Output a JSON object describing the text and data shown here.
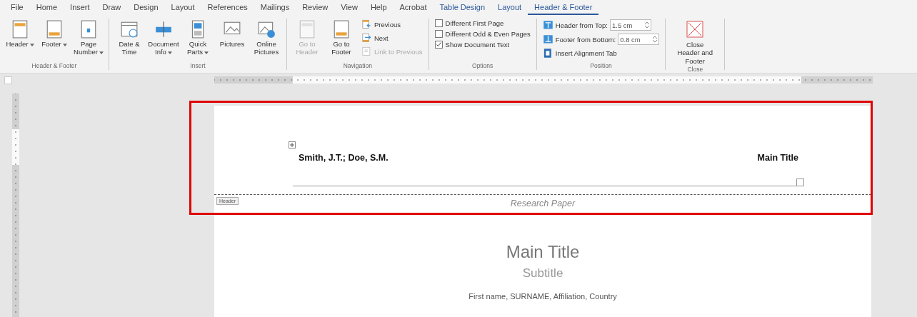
{
  "tabs": [
    {
      "label": "File",
      "selected": false,
      "contextual": false
    },
    {
      "label": "Home",
      "selected": false,
      "contextual": false
    },
    {
      "label": "Insert",
      "selected": false,
      "contextual": false
    },
    {
      "label": "Draw",
      "selected": false,
      "contextual": false
    },
    {
      "label": "Design",
      "selected": false,
      "contextual": false
    },
    {
      "label": "Layout",
      "selected": false,
      "contextual": false
    },
    {
      "label": "References",
      "selected": false,
      "contextual": false
    },
    {
      "label": "Mailings",
      "selected": false,
      "contextual": false
    },
    {
      "label": "Review",
      "selected": false,
      "contextual": false
    },
    {
      "label": "View",
      "selected": false,
      "contextual": false
    },
    {
      "label": "Help",
      "selected": false,
      "contextual": false
    },
    {
      "label": "Acrobat",
      "selected": false,
      "contextual": false
    },
    {
      "label": "Table Design",
      "selected": false,
      "contextual": true
    },
    {
      "label": "Layout",
      "selected": false,
      "contextual": true
    },
    {
      "label": "Header & Footer",
      "selected": true,
      "contextual": true
    }
  ],
  "ribbon": {
    "groups": [
      {
        "label": "Header & Footer",
        "items": [
          {
            "kind": "large",
            "label": "Header",
            "dropdown": true,
            "disabled": false
          },
          {
            "kind": "large",
            "label": "Footer",
            "dropdown": true,
            "disabled": false
          },
          {
            "kind": "large",
            "label": "Page Number",
            "dropdown": true,
            "disabled": false
          }
        ]
      },
      {
        "label": "Insert",
        "items": [
          {
            "kind": "large",
            "label": "Date & Time",
            "dropdown": false,
            "disabled": false
          },
          {
            "kind": "large",
            "label": "Document Info",
            "dropdown": true,
            "disabled": false
          },
          {
            "kind": "large",
            "label": "Quick Parts",
            "dropdown": true,
            "disabled": false
          },
          {
            "kind": "large",
            "label": "Pictures",
            "dropdown": false,
            "disabled": false
          },
          {
            "kind": "large",
            "label": "Online Pictures",
            "dropdown": false,
            "disabled": false
          }
        ]
      },
      {
        "label": "Navigation",
        "items": [
          {
            "kind": "large",
            "label": "Go to Header",
            "dropdown": false,
            "disabled": true
          },
          {
            "kind": "large",
            "label": "Go to Footer",
            "dropdown": false,
            "disabled": false
          },
          {
            "kind": "small",
            "label": "Previous",
            "disabled": false
          },
          {
            "kind": "small",
            "label": "Next",
            "disabled": false
          },
          {
            "kind": "small",
            "label": "Link to Previous",
            "disabled": true
          }
        ]
      },
      {
        "label": "Options",
        "items": [
          {
            "kind": "checkbox",
            "label": "Different First Page",
            "checked": false
          },
          {
            "kind": "checkbox",
            "label": "Different Odd & Even Pages",
            "checked": false
          },
          {
            "kind": "checkbox",
            "label": "Show Document Text",
            "checked": true
          }
        ]
      },
      {
        "label": "Position",
        "items": [
          {
            "kind": "spinner",
            "label": "Header from Top:",
            "value": "1.5 cm"
          },
          {
            "kind": "spinner",
            "label": "Footer from Bottom:",
            "value": "0.8 cm"
          },
          {
            "kind": "small",
            "label": "Insert Alignment Tab",
            "disabled": false
          }
        ]
      },
      {
        "label": "Close",
        "items": [
          {
            "kind": "close",
            "label": "Close Header and Footer"
          }
        ]
      }
    ]
  },
  "document": {
    "header": {
      "authors": "Smith, J.T.; Doe, S.M.",
      "title": "Main Title",
      "tag": "Header",
      "second_line": "Research Paper"
    },
    "body": {
      "title": "Main Title",
      "subtitle": "Subtitle",
      "authors_line": "First name, SURNAME, Affiliation, Country"
    }
  }
}
